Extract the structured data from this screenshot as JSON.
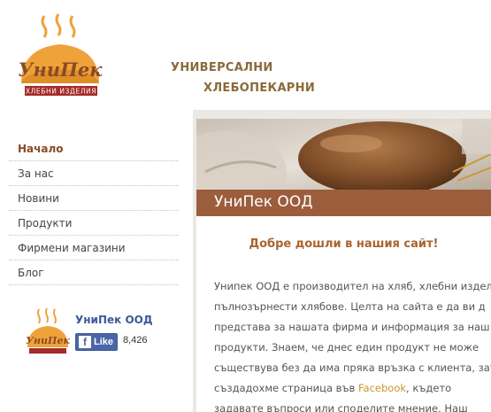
{
  "header": {
    "logo": {
      "brand": "УниПек",
      "sub": "ХЛЕБНИ ИЗДЕЛИЯ",
      "colors": {
        "orange": "#f0a23a",
        "brown": "#8a4a25",
        "red": "#a52a2a"
      }
    },
    "tagline_line1": "УНИВЕРСАЛНИ",
    "tagline_line2": "ХЛЕБОПЕКАРНИ"
  },
  "sidebar": {
    "menu": [
      {
        "label": "Начало",
        "active": true
      },
      {
        "label": "За нас"
      },
      {
        "label": "Новини"
      },
      {
        "label": "Продукти"
      },
      {
        "label": "Фирмени магазини"
      },
      {
        "label": "Блог"
      }
    ],
    "facebook": {
      "page_name": "УниПек ООД",
      "like_label": "Like",
      "like_count": "8,426"
    }
  },
  "main": {
    "hero_image": "bread-on-cloth",
    "title": "УниПек ООД",
    "welcome": "Добре дошли в нашия сайт!",
    "paragraph_lines": [
      "Унипек ООД е производител на хляб, хлебни издел",
      "пълнозърнести хлябове. Целта на сайта е да ви д",
      "представа за нашата фирма и информация за наш",
      "продукти. Знаем, че днес един продукт не може",
      "съществува без да има пряка връзка с клиента, зат",
      "създадохме страница във ",
      "задавате въпроси или споделите мнение. Наш"
    ],
    "facebook_link": "Facebook",
    "after_link": ", където"
  }
}
